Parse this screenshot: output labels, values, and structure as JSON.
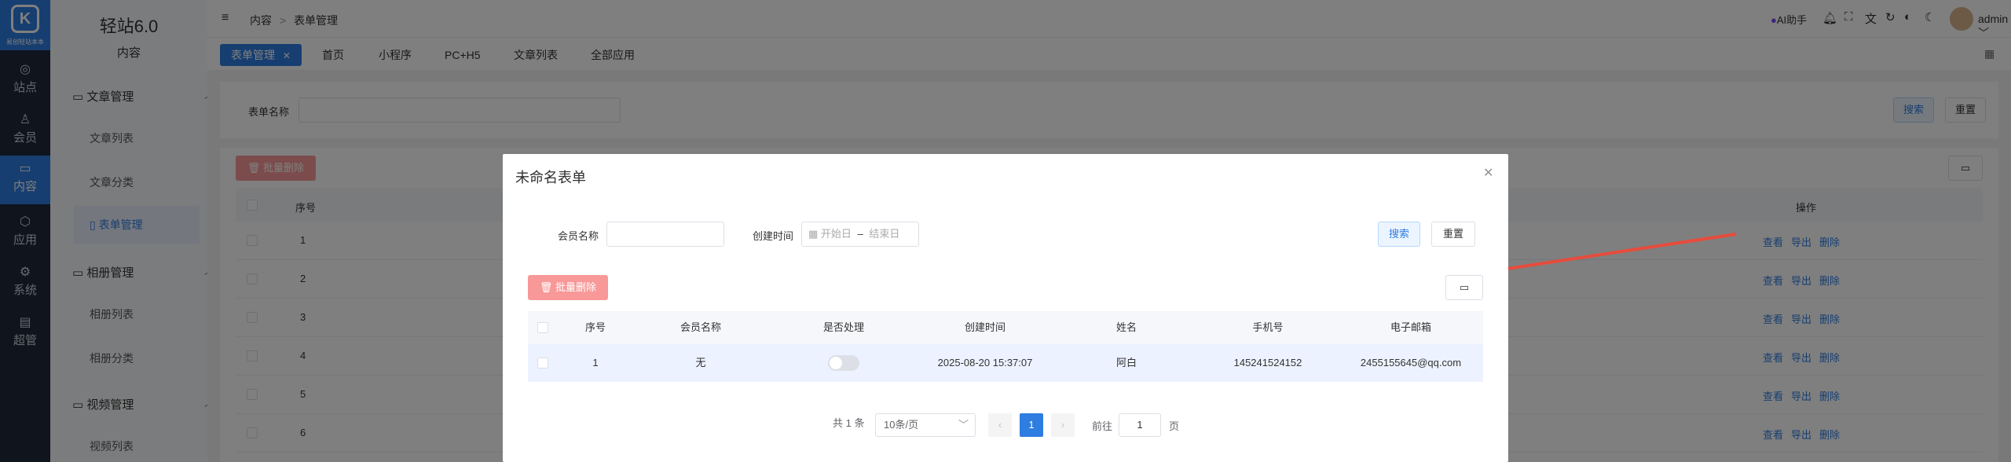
{
  "rail": {
    "logo_text": "易创轻站本本",
    "items": [
      {
        "label": "站点",
        "icon": "globe-icon"
      },
      {
        "label": "会员",
        "icon": "user-icon"
      },
      {
        "label": "内容",
        "icon": "folder-icon"
      },
      {
        "label": "应用",
        "icon": "cube-icon"
      },
      {
        "label": "系统",
        "icon": "gear-icon"
      },
      {
        "label": "超管",
        "icon": "briefcase-icon"
      }
    ]
  },
  "sidebar": {
    "brand": "轻站6.0",
    "section": "内容",
    "groups": [
      {
        "label": "文章管理",
        "items": [
          "文章列表",
          "文章分类",
          "表单管理"
        ]
      },
      {
        "label": "相册管理",
        "items": [
          "相册列表",
          "相册分类"
        ]
      },
      {
        "label": "视频管理",
        "items": [
          "视频列表"
        ]
      }
    ],
    "active_item": "表单管理"
  },
  "topbar": {
    "breadcrumb": [
      "内容",
      "表单管理"
    ],
    "breadcrumb_sep": ">",
    "ai_label": "AI助手",
    "user": "admin"
  },
  "tabs": [
    {
      "label": "表单管理",
      "active": true
    },
    {
      "label": "首页"
    },
    {
      "label": "小程序"
    },
    {
      "label": "PC+H5"
    },
    {
      "label": "文章列表"
    },
    {
      "label": "全部应用"
    }
  ],
  "filter": {
    "label": "表单名称",
    "search": "搜索",
    "reset": "重置"
  },
  "bulk_delete": "批量删除",
  "list": {
    "headers": {
      "index": "序号",
      "actions": "操作"
    },
    "rows": [
      "1",
      "2",
      "3",
      "4",
      "5",
      "6"
    ],
    "actions": [
      "查看",
      "导出",
      "删除"
    ]
  },
  "dialog": {
    "title": "未命名表单",
    "member_label": "会员名称",
    "time_label": "创建时间",
    "start_placeholder": "开始日",
    "end_placeholder": "结束日",
    "range_sep": "–",
    "search": "搜索",
    "reset": "重置",
    "bulk_delete": "批量删除",
    "headers": [
      "序号",
      "会员名称",
      "是否处理",
      "创建时间",
      "姓名",
      "手机号",
      "电子邮箱"
    ],
    "rows": [
      {
        "index": "1",
        "member": "无",
        "processed": false,
        "created": "2025-08-20 15:37:07",
        "name": "阿白",
        "phone": "145241524152",
        "email": "2455155645@qq.com"
      }
    ],
    "pagination": {
      "total": "共 1 条",
      "page_size": "10条/页",
      "current": "1",
      "goto_label": "前往",
      "goto_value": "1",
      "page_suffix": "页"
    }
  },
  "colors": {
    "primary": "#2e7de0",
    "danger_light": "#f89898",
    "annotation_arrow": "#e74c3c"
  }
}
